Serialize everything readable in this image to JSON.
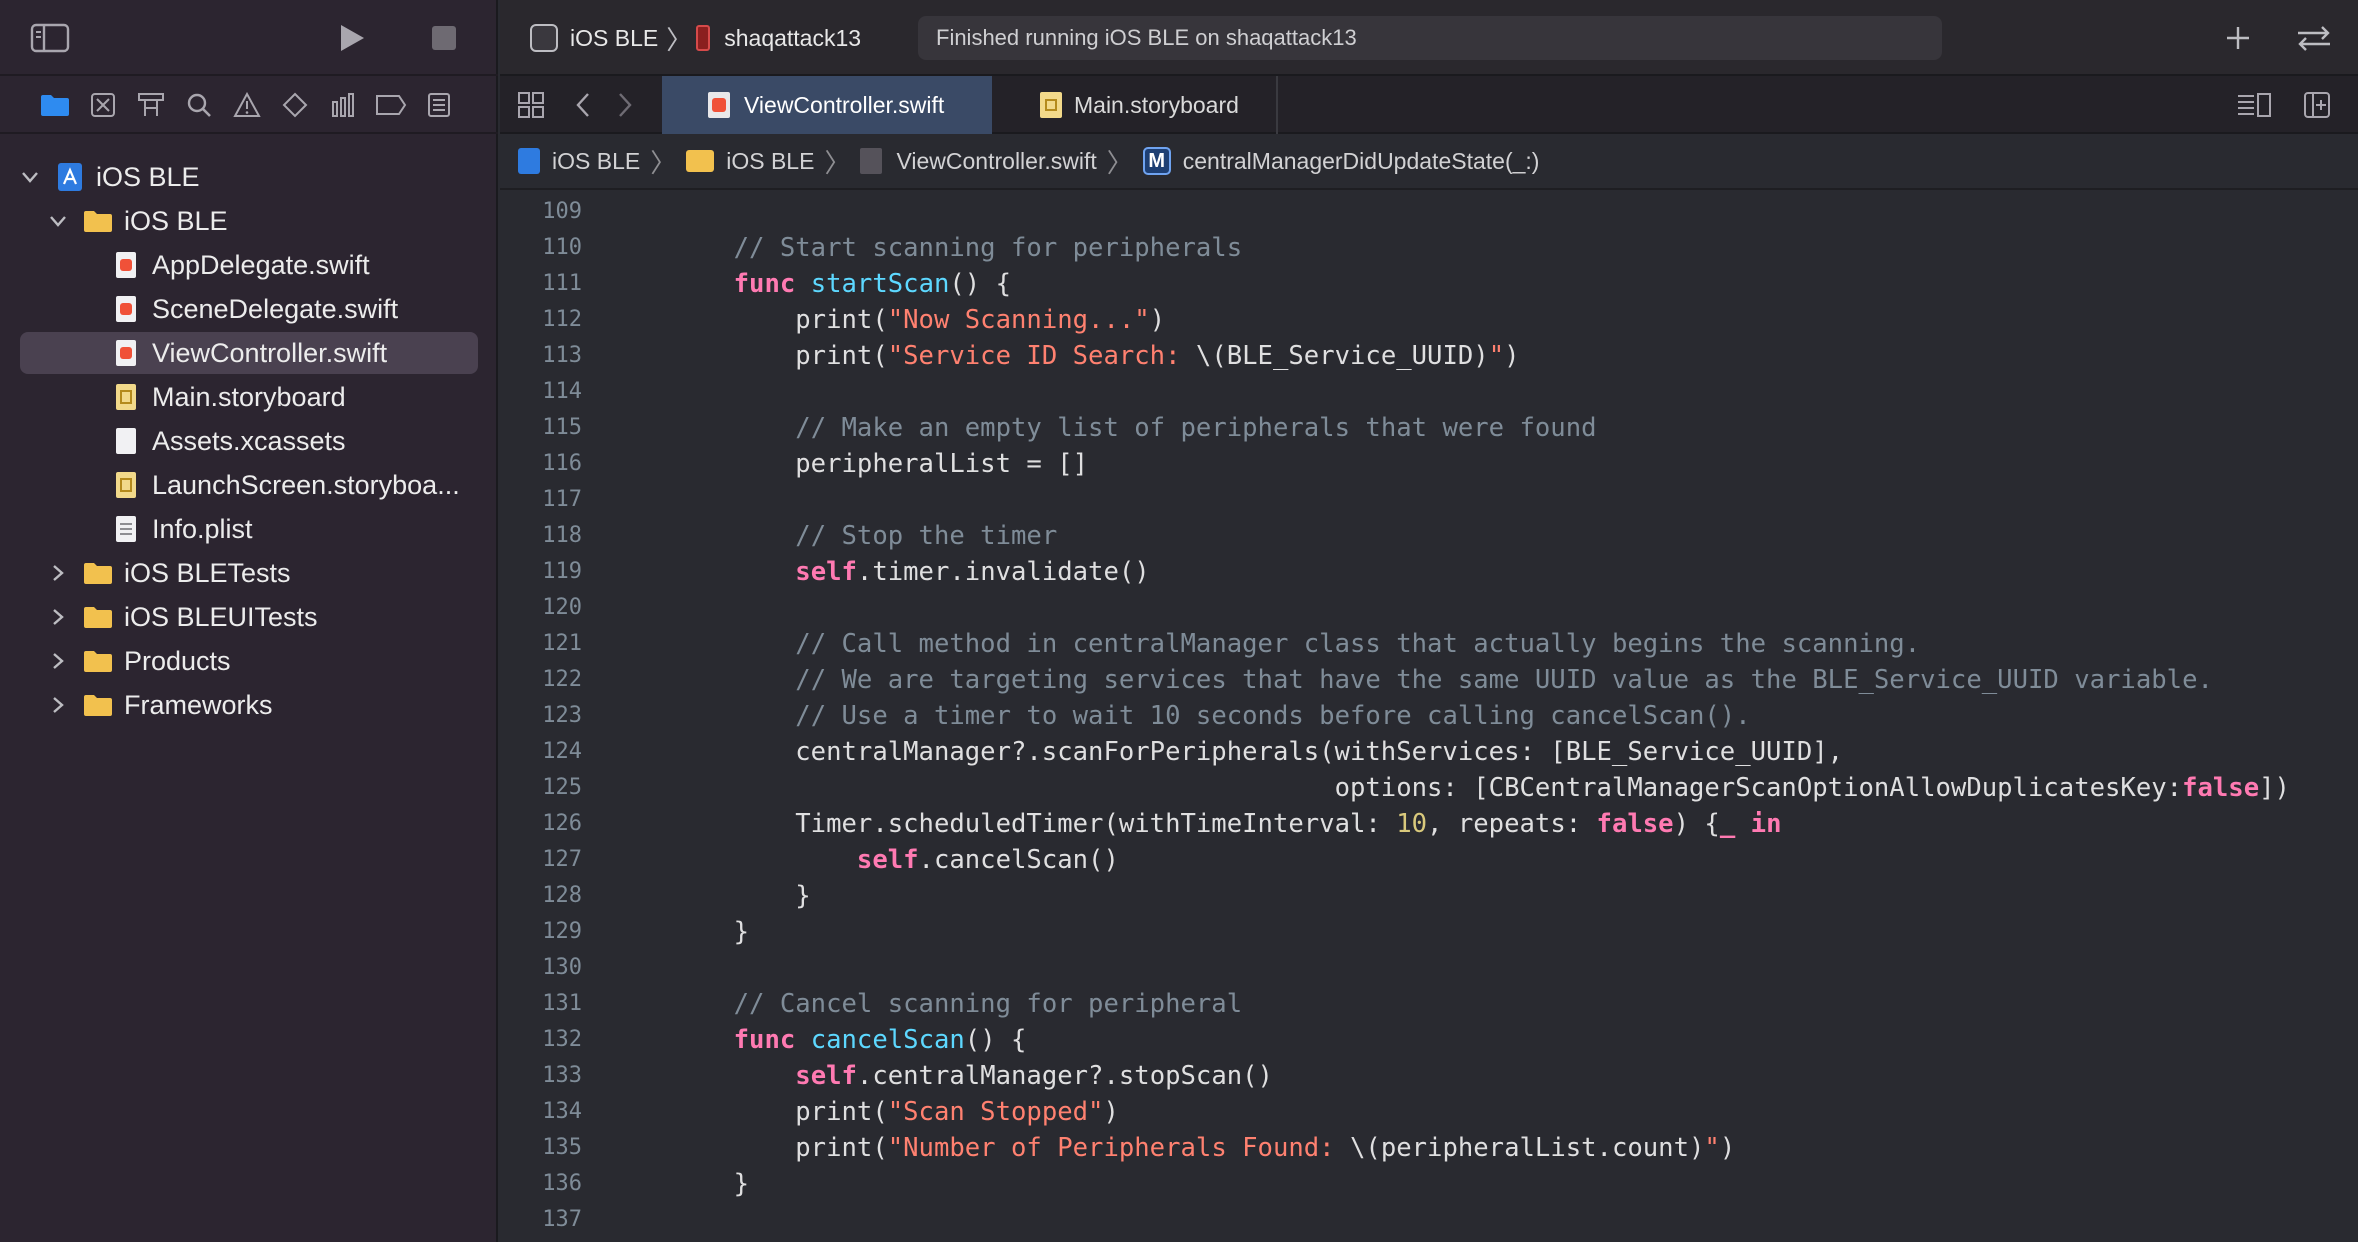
{
  "window": {
    "scheme_target": "iOS BLE",
    "device": "shaqattack13",
    "activity_status": "Finished running iOS BLE on shaqattack13"
  },
  "navigator_icons": [
    "folder-icon",
    "source-control-icon",
    "symbol-icon",
    "find-icon",
    "issue-icon",
    "test-icon",
    "debug-icon",
    "breakpoint-icon",
    "report-icon"
  ],
  "project_tree": [
    {
      "label": "iOS BLE",
      "kind": "project",
      "expanded": true
    },
    {
      "label": "iOS BLE",
      "kind": "folder",
      "expanded": true
    },
    {
      "label": "AppDelegate.swift",
      "kind": "swift"
    },
    {
      "label": "SceneDelegate.swift",
      "kind": "swift"
    },
    {
      "label": "ViewController.swift",
      "kind": "swift",
      "selected": true
    },
    {
      "label": "Main.storyboard",
      "kind": "storyboard"
    },
    {
      "label": "Assets.xcassets",
      "kind": "assets"
    },
    {
      "label": "LaunchScreen.storyboa...",
      "kind": "storyboard"
    },
    {
      "label": "Info.plist",
      "kind": "plist"
    },
    {
      "label": "iOS BLETests",
      "kind": "folder",
      "expanded": false
    },
    {
      "label": "iOS BLEUITests",
      "kind": "folder",
      "expanded": false
    },
    {
      "label": "Products",
      "kind": "folder",
      "expanded": false
    },
    {
      "label": "Frameworks",
      "kind": "folder",
      "expanded": false
    }
  ],
  "tabs": [
    {
      "label": "ViewController.swift",
      "active": true
    },
    {
      "label": "Main.storyboard",
      "active": false
    }
  ],
  "breadcrumb": [
    {
      "label": "iOS BLE",
      "icon": "project-icon"
    },
    {
      "label": "iOS BLE",
      "icon": "folder-icon"
    },
    {
      "label": "ViewController.swift",
      "icon": "swift-file-icon"
    },
    {
      "label": "centralManagerDidUpdateState(_:)",
      "icon": "method-icon",
      "badge": "M"
    }
  ],
  "code_lines": [
    {
      "n": "109",
      "tokens": []
    },
    {
      "n": "110",
      "tokens": [
        {
          "t": "    "
        },
        {
          "t": "// Start scanning for peripherals",
          "c": "comment"
        }
      ]
    },
    {
      "n": "111",
      "tokens": [
        {
          "t": "    "
        },
        {
          "t": "func",
          "c": "keyword"
        },
        {
          "t": " "
        },
        {
          "t": "startScan",
          "c": "func"
        },
        {
          "t": "() {"
        }
      ]
    },
    {
      "n": "112",
      "tokens": [
        {
          "t": "        print("
        },
        {
          "t": "\"Now Scanning...\"",
          "c": "string"
        },
        {
          "t": ")"
        }
      ]
    },
    {
      "n": "113",
      "tokens": [
        {
          "t": "        print("
        },
        {
          "t": "\"Service ID Search: ",
          "c": "string"
        },
        {
          "t": "\\(BLE_Service_UUID)"
        },
        {
          "t": "\"",
          "c": "string"
        },
        {
          "t": ")"
        }
      ]
    },
    {
      "n": "114",
      "tokens": []
    },
    {
      "n": "115",
      "tokens": [
        {
          "t": "        "
        },
        {
          "t": "// Make an empty list of peripherals that were found",
          "c": "comment"
        }
      ]
    },
    {
      "n": "116",
      "tokens": [
        {
          "t": "        peripheralList = []"
        }
      ]
    },
    {
      "n": "117",
      "tokens": []
    },
    {
      "n": "118",
      "tokens": [
        {
          "t": "        "
        },
        {
          "t": "// Stop the timer",
          "c": "comment"
        }
      ]
    },
    {
      "n": "119",
      "tokens": [
        {
          "t": "        "
        },
        {
          "t": "self",
          "c": "keyword"
        },
        {
          "t": ".timer.invalidate()"
        }
      ]
    },
    {
      "n": "120",
      "tokens": []
    },
    {
      "n": "121",
      "tokens": [
        {
          "t": "        "
        },
        {
          "t": "// Call method in centralManager class that actually begins the scanning.",
          "c": "comment"
        }
      ]
    },
    {
      "n": "122",
      "tokens": [
        {
          "t": "        "
        },
        {
          "t": "// We are targeting services that have the same UUID value as the BLE_Service_UUID variable.",
          "c": "comment"
        }
      ]
    },
    {
      "n": "123",
      "tokens": [
        {
          "t": "        "
        },
        {
          "t": "// Use a timer to wait 10 seconds before calling cancelScan().",
          "c": "comment"
        }
      ]
    },
    {
      "n": "124",
      "tokens": [
        {
          "t": "        centralManager?.scanForPeripherals(withServices: [BLE_Service_UUID],"
        }
      ]
    },
    {
      "n": "125",
      "tokens": [
        {
          "t": "                                           options: [CBCentralManagerScanOptionAllowDuplicatesKey:"
        },
        {
          "t": "false",
          "c": "keyword"
        },
        {
          "t": "])"
        }
      ]
    },
    {
      "n": "126",
      "tokens": [
        {
          "t": "        Timer.scheduledTimer(withTimeInterval: "
        },
        {
          "t": "10",
          "c": "number"
        },
        {
          "t": ", repeats: "
        },
        {
          "t": "false",
          "c": "keyword"
        },
        {
          "t": ") {"
        },
        {
          "t": "_",
          "c": "keyword"
        },
        {
          "t": " "
        },
        {
          "t": "in",
          "c": "keyword"
        }
      ]
    },
    {
      "n": "127",
      "tokens": [
        {
          "t": "            "
        },
        {
          "t": "self",
          "c": "keyword"
        },
        {
          "t": ".cancelScan()"
        }
      ]
    },
    {
      "n": "128",
      "tokens": [
        {
          "t": "        }"
        }
      ]
    },
    {
      "n": "129",
      "tokens": [
        {
          "t": "    }"
        }
      ]
    },
    {
      "n": "130",
      "tokens": []
    },
    {
      "n": "131",
      "tokens": [
        {
          "t": "    "
        },
        {
          "t": "// Cancel scanning for peripheral",
          "c": "comment"
        }
      ]
    },
    {
      "n": "132",
      "tokens": [
        {
          "t": "    "
        },
        {
          "t": "func",
          "c": "keyword"
        },
        {
          "t": " "
        },
        {
          "t": "cancelScan",
          "c": "func"
        },
        {
          "t": "() {"
        }
      ]
    },
    {
      "n": "133",
      "tokens": [
        {
          "t": "        "
        },
        {
          "t": "self",
          "c": "keyword"
        },
        {
          "t": ".centralManager?.stopScan()"
        }
      ]
    },
    {
      "n": "134",
      "tokens": [
        {
          "t": "        print("
        },
        {
          "t": "\"Scan Stopped\"",
          "c": "string"
        },
        {
          "t": ")"
        }
      ]
    },
    {
      "n": "135",
      "tokens": [
        {
          "t": "        print("
        },
        {
          "t": "\"Number of Peripherals Found: ",
          "c": "string"
        },
        {
          "t": "\\(peripheralList.count)"
        },
        {
          "t": "\"",
          "c": "string"
        },
        {
          "t": ")"
        }
      ]
    },
    {
      "n": "136",
      "tokens": [
        {
          "t": "    }"
        }
      ]
    },
    {
      "n": "137",
      "tokens": []
    }
  ],
  "colors": {
    "sidebar_bg": "#2C2530",
    "editor_bg": "#292A30",
    "selection": "#4A4150",
    "active_tab": "#3A4A66",
    "comment": "#7F8C98",
    "keyword": "#FF7AB2",
    "string": "#FF8170",
    "number": "#D9C97C",
    "function": "#5DD8FF",
    "folder": "#F2C14E"
  }
}
